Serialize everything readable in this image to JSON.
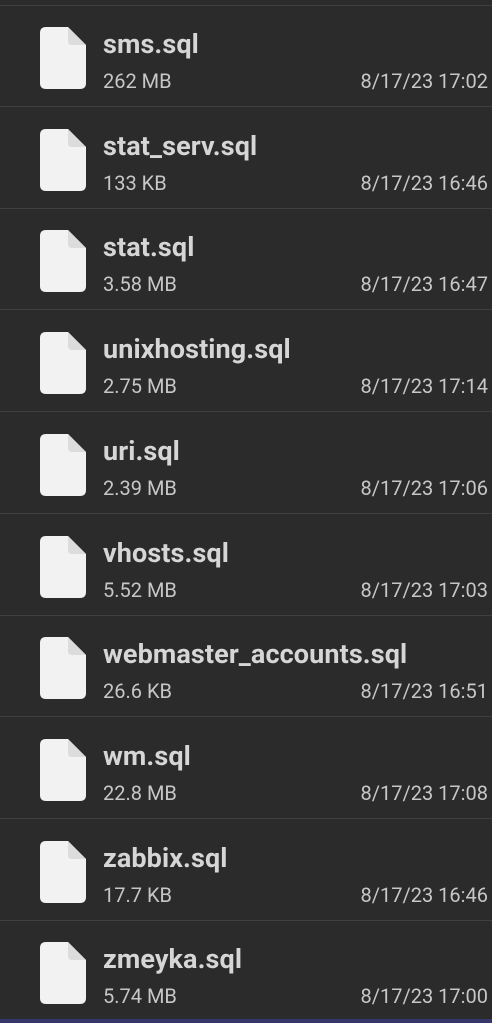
{
  "files": [
    {
      "icon": "file-icon",
      "name": "sms.sql",
      "size": "262 MB",
      "date": "8/17/23 17:02"
    },
    {
      "icon": "file-icon",
      "name": "stat_serv.sql",
      "size": "133 KB",
      "date": "8/17/23 16:46"
    },
    {
      "icon": "file-icon",
      "name": "stat.sql",
      "size": "3.58 MB",
      "date": "8/17/23 16:47"
    },
    {
      "icon": "file-icon",
      "name": "unixhosting.sql",
      "size": "2.75 MB",
      "date": "8/17/23 17:14"
    },
    {
      "icon": "file-icon",
      "name": "uri.sql",
      "size": "2.39 MB",
      "date": "8/17/23 17:06"
    },
    {
      "icon": "file-icon",
      "name": "vhosts.sql",
      "size": "5.52 MB",
      "date": "8/17/23 17:03"
    },
    {
      "icon": "file-icon",
      "name": "webmaster_accounts.sql",
      "size": "26.6 KB",
      "date": "8/17/23 16:51"
    },
    {
      "icon": "file-icon",
      "name": "wm.sql",
      "size": "22.8 MB",
      "date": "8/17/23 17:08"
    },
    {
      "icon": "file-icon",
      "name": "zabbix.sql",
      "size": "17.7 KB",
      "date": "8/17/23 16:46"
    },
    {
      "icon": "file-icon",
      "name": "zmeyka.sql",
      "size": "5.74 MB",
      "date": "8/17/23 17:00"
    }
  ],
  "colors": {
    "background": "#2b2b2b",
    "divider": "#3f3f3f",
    "name_text": "#d6d6d6",
    "meta_text": "#c7c7c7",
    "icon_fill": "#f2f2f2",
    "bottom_bar": "#35376a"
  }
}
